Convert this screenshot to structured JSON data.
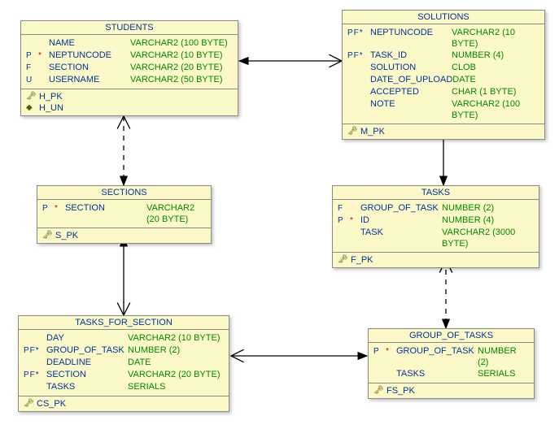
{
  "entities": {
    "students": {
      "title": "STUDENTS",
      "cols": [
        {
          "flags": "    ",
          "name": "NAME",
          "type": "VARCHAR2 (100 BYTE)"
        },
        {
          "flags": "P  *",
          "red": true,
          "name": "NEPTUNCODE",
          "type": "VARCHAR2 (10 BYTE)"
        },
        {
          "flags": "F   ",
          "name": "SECTION",
          "type": "VARCHAR2 (20 BYTE)"
        },
        {
          "flags": "U   ",
          "name": "USERNAME",
          "type": "VARCHAR2 (50 BYTE)"
        }
      ],
      "keys": [
        {
          "icon": "🗝",
          "name": "H_PK"
        },
        {
          "icon": "◆",
          "name": "H_UN"
        }
      ]
    },
    "solutions": {
      "title": "SOLUTIONS",
      "cols": [
        {
          "flags": "PF*",
          "name": "NEPTUNCODE",
          "type": "VARCHAR2 (10 BYTE)"
        },
        {
          "flags": "PF*",
          "name": "TASK_ID",
          "type": "NUMBER (4)"
        },
        {
          "flags": "   ",
          "name": "SOLUTION",
          "type": "CLOB"
        },
        {
          "flags": "   ",
          "name": "DATE_OF_UPLOAD",
          "type": "DATE"
        },
        {
          "flags": "   ",
          "name": "ACCEPTED",
          "type": "CHAR (1 BYTE)"
        },
        {
          "flags": "   ",
          "name": "NOTE",
          "type": "VARCHAR2 (100 BYTE)"
        }
      ],
      "keys": [
        {
          "icon": "🗝",
          "name": "M_PK"
        }
      ]
    },
    "sections": {
      "title": "SECTIONS",
      "cols": [
        {
          "flags": "P  *",
          "red": true,
          "name": "SECTION",
          "type": "VARCHAR2 (20 BYTE)"
        }
      ],
      "keys": [
        {
          "icon": "🗝",
          "name": "S_PK"
        }
      ]
    },
    "tasks": {
      "title": "TASKS",
      "cols": [
        {
          "flags": "F   ",
          "name": "GROUP_OF_TASK",
          "type": "NUMBER (2)"
        },
        {
          "flags": "P  *",
          "red": true,
          "name": "ID",
          "type": "NUMBER (4)"
        },
        {
          "flags": "    ",
          "name": "TASK",
          "type": "VARCHAR2 (3000 BYTE)"
        }
      ],
      "keys": [
        {
          "icon": "🗝",
          "name": "F_PK"
        }
      ]
    },
    "tasks_for_section": {
      "title": "TASKS_FOR_SECTION",
      "cols": [
        {
          "flags": "    ",
          "name": "DAY",
          "type": "VARCHAR2 (10 BYTE)"
        },
        {
          "flags": "PF*",
          "name": "GROUP_OF_TASK",
          "type": "NUMBER (2)"
        },
        {
          "flags": "    ",
          "name": "DEADLINE",
          "type": "DATE"
        },
        {
          "flags": "PF*",
          "name": "SECTION",
          "type": "VARCHAR2 (20 BYTE)"
        },
        {
          "flags": "    ",
          "name": "TASKS",
          "type": "SERIALS"
        }
      ],
      "keys": [
        {
          "icon": "🗝",
          "name": "CS_PK"
        }
      ]
    },
    "group_of_tasks": {
      "title": "GROUP_OF_TASKS",
      "cols": [
        {
          "flags": "P  *",
          "red": true,
          "name": "GROUP_OF_TASK",
          "type": "NUMBER (2)"
        },
        {
          "flags": "    ",
          "name": "TASKS",
          "type": "SERIALS"
        }
      ],
      "keys": [
        {
          "icon": "🗝",
          "name": "FS_PK"
        }
      ]
    }
  }
}
